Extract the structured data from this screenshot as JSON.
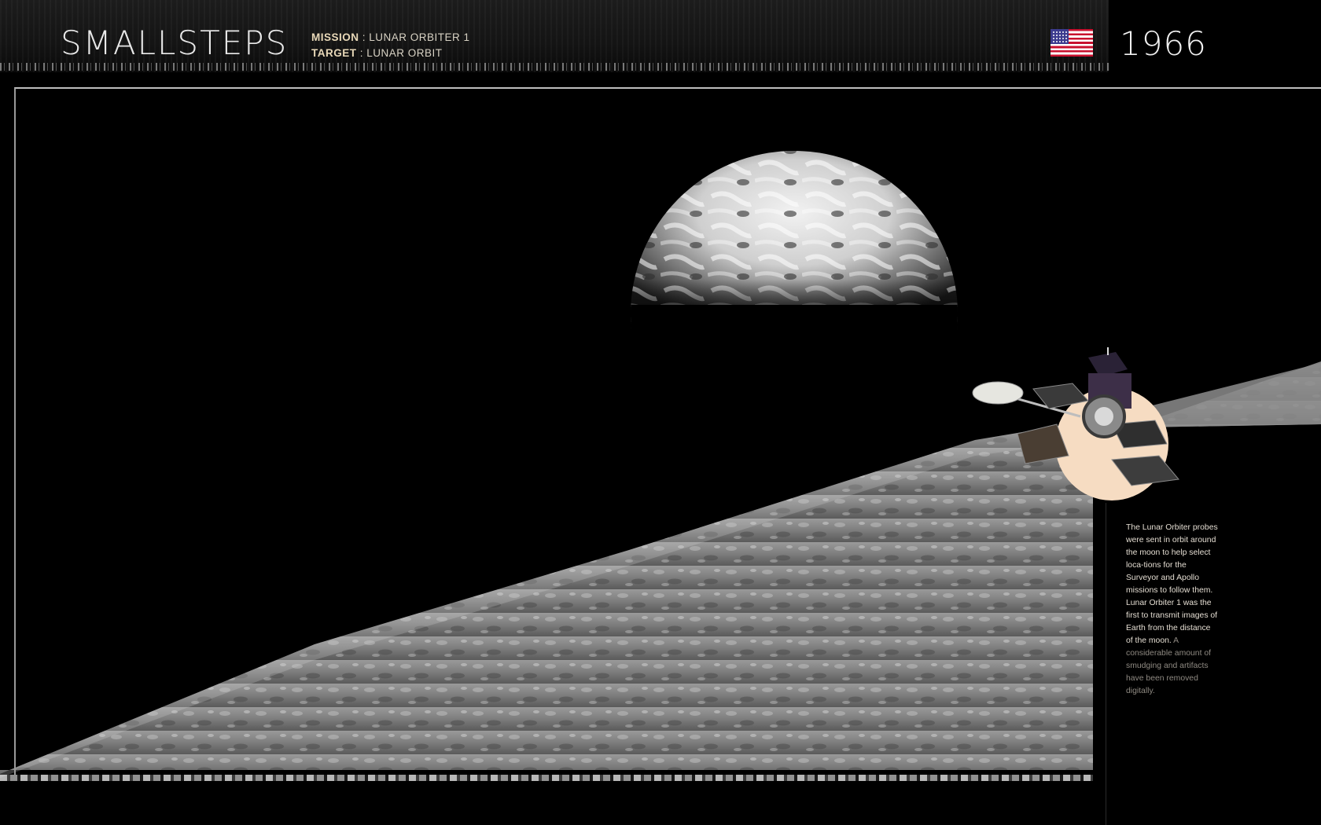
{
  "header": {
    "brand": "SMALLSTEPS",
    "mission_key": "MISSION",
    "mission_value": "LUNAR ORBITER 1",
    "target_key": "TARGET",
    "target_value": "LUNAR ORBIT",
    "sep": " : ",
    "year": "1966",
    "flag_icon": "us-flag-icon"
  },
  "photo": {
    "subject": "earth-over-lunar-horizon-image",
    "earth_icon": "earth-icon",
    "moon_surface": "lunar-surface-image"
  },
  "orbiter": {
    "icon": "lunar-orbiter-spacecraft-icon",
    "disc_color": "#f6dcc2"
  },
  "caption": {
    "main": "The Lunar Orbiter probes were sent in orbit around the moon to help select loca-tions for the Surveyor and Apollo missions to follow them. Lunar Orbiter 1 was the first to transmit images of Earth from the distance of the moon.",
    "note": "A considerable amount of smudging and artifacts have been removed digitally."
  },
  "colors": {
    "background": "#000000",
    "caption_text": "#e4ddd2",
    "caption_note": "#8f8a82",
    "meta_key": "#e8d8b8"
  }
}
